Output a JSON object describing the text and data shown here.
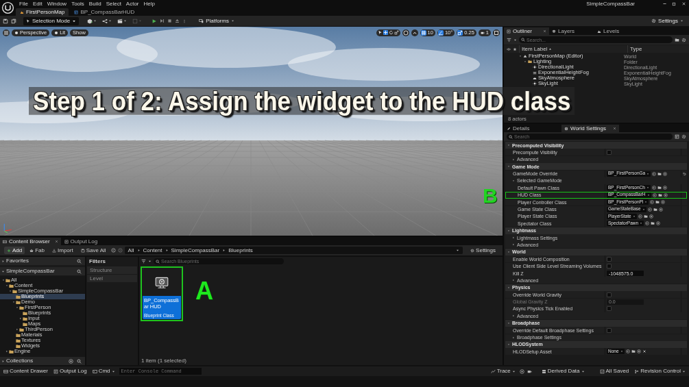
{
  "menu_bar": {
    "menus": [
      "File",
      "Edit",
      "Window",
      "Tools",
      "Build",
      "Select",
      "Actor",
      "Help"
    ],
    "project": "SimpleCompassBar"
  },
  "document_tabs": [
    {
      "label": "FirstPersonMap",
      "kind": "level",
      "selected": true
    },
    {
      "label": "BP_CompassBarHUD",
      "kind": "blueprint",
      "selected": false
    }
  ],
  "toolbar": {
    "mode": "Selection Mode",
    "platforms": "Platforms",
    "settings": "Settings"
  },
  "viewport": {
    "view": "Perspective",
    "lighting": "Lit",
    "show": "Show",
    "grid_snap": "10",
    "rotation_snap": "10°",
    "scale_snap": "0.25",
    "camera_speed": "1",
    "overlay_title": "Step 1 of 2: Assign the widget to the HUD class",
    "marker": "B"
  },
  "outliner": {
    "tabs": [
      {
        "label": "Outliner",
        "selected": true
      },
      {
        "label": "Layers",
        "selected": false
      },
      {
        "label": "Levels",
        "selected": false
      }
    ],
    "search_placeholder": "Search...",
    "columns": [
      "Item Label",
      "Type"
    ],
    "rows": [
      {
        "label": "FirstPersonMap (Editor)",
        "type": "World",
        "kind": "world",
        "expanded": true,
        "children": [
          {
            "label": "Lighting",
            "type": "Folder",
            "kind": "folder",
            "expanded": true,
            "children": [
              {
                "label": "DirectionalLight",
                "type": "DirectionalLight",
                "kind": "light"
              },
              {
                "label": "ExponentialHeightFog",
                "type": "ExponentialHeightFog",
                "kind": "fog"
              },
              {
                "label": "SkyAtmosphere",
                "type": "SkyAtmosphere",
                "kind": "sky"
              },
              {
                "label": "SkyLight",
                "type": "SkyLight",
                "kind": "light"
              }
            ]
          }
        ]
      }
    ],
    "footer": "8 actors"
  },
  "details": {
    "tabs": [
      {
        "label": "Details",
        "selected": false
      },
      {
        "label": "World Settings",
        "selected": true
      }
    ],
    "search_placeholder": "Search",
    "rows": [
      {
        "kind": "category",
        "label": "Precomputed Visibility",
        "expanded": true,
        "children": [
          {
            "kind": "checkbox",
            "label": "Precompute Visibility",
            "checked": false
          },
          {
            "kind": "group",
            "label": "Advanced",
            "expanded": false
          }
        ]
      },
      {
        "kind": "category",
        "label": "Game Mode",
        "expanded": true,
        "children": [
          {
            "kind": "asset",
            "label": "GameMode Override",
            "value": "BP_FirstPersonGa",
            "modified": true
          },
          {
            "kind": "group",
            "label": "Selected GameMode",
            "expanded": true,
            "children": [
              {
                "kind": "asset",
                "label": "Default Pawn Class",
                "value": "BP_FirstPersonCh"
              },
              {
                "kind": "asset",
                "label": "HUD Class",
                "value": "BP_CompassBarH",
                "highlighted": true
              },
              {
                "kind": "asset",
                "label": "Player Controller Class",
                "value": "BP_FirstPersonPl"
              },
              {
                "kind": "asset",
                "label": "Game State Class",
                "value": "GameStateBase"
              },
              {
                "kind": "asset",
                "label": "Player State Class",
                "value": "PlayerState"
              },
              {
                "kind": "asset",
                "label": "Spectator Class",
                "value": "SpectatorPawn"
              }
            ]
          }
        ]
      },
      {
        "kind": "category",
        "label": "Lightmass",
        "expanded": true,
        "children": [
          {
            "kind": "group",
            "label": "Lightmass Settings",
            "expanded": false
          },
          {
            "kind": "group",
            "label": "Advanced",
            "expanded": false
          }
        ]
      },
      {
        "kind": "category",
        "label": "World",
        "expanded": true,
        "children": [
          {
            "kind": "checkbox",
            "label": "Enable World Composition",
            "checked": false
          },
          {
            "kind": "checkbox",
            "label": "Use Client Side Level Streaming Volumes",
            "checked": false
          },
          {
            "kind": "number",
            "label": "Kill Z",
            "value": "-1048575.0",
            "disabled": false
          },
          {
            "kind": "group",
            "label": "Advanced",
            "expanded": false
          }
        ]
      },
      {
        "kind": "category",
        "label": "Physics",
        "expanded": true,
        "children": [
          {
            "kind": "checkbox",
            "label": "Override World Gravity",
            "checked": false
          },
          {
            "kind": "number",
            "label": "Global Gravity Z",
            "value": "0.0",
            "disabled": true
          },
          {
            "kind": "checkbox",
            "label": "Async Physics Tick Enabled",
            "checked": false
          },
          {
            "kind": "group",
            "label": "Advanced",
            "expanded": false
          }
        ]
      },
      {
        "kind": "category",
        "label": "Broadphase",
        "expanded": true,
        "children": [
          {
            "kind": "checkbox",
            "label": "Override Default Broadphase Settings",
            "checked": false
          },
          {
            "kind": "group",
            "label": "Broadphase Settings",
            "expanded": false
          }
        ]
      },
      {
        "kind": "category",
        "label": "HLODSystem",
        "expanded": true,
        "children": [
          {
            "kind": "asset",
            "label": "HLODSetup Asset",
            "value": "None",
            "clearable": true
          }
        ]
      }
    ]
  },
  "content_browser": {
    "tabs": [
      {
        "label": "Content Browser",
        "selected": true
      },
      {
        "label": "Output Log",
        "selected": false
      }
    ],
    "actions": [
      "Add",
      "Fab",
      "Import",
      "Save All"
    ],
    "breadcrumb": [
      "All",
      "Content",
      "SimpleCompassBar",
      "Blueprints"
    ],
    "settings": "Settings",
    "favorites": "Favorites",
    "project": "SimpleCompassBar",
    "tree": [
      {
        "label": "All",
        "expanded": true,
        "selected": false,
        "children": [
          {
            "label": "Content",
            "expanded": true,
            "selected": false,
            "children": [
              {
                "label": "SimpleCompassBar",
                "expanded": true,
                "selected": false,
                "children": [
                  {
                    "label": "Blueprints",
                    "selected": true
                  },
                  {
                    "label": "Demo",
                    "expanded": true,
                    "selected": false,
                    "children": [
                      {
                        "label": "FirstPerson",
                        "expanded": true,
                        "selected": false,
                        "children": [
                          {
                            "label": "Blueprints",
                            "selected": false
                          },
                          {
                            "label": "Input",
                            "expanded": false,
                            "selected": false
                          },
                          {
                            "label": "Maps",
                            "selected": false
                          }
                        ]
                      },
                      {
                        "label": "ThirdPerson",
                        "expanded": false,
                        "selected": false
                      }
                    ]
                  },
                  {
                    "label": "Materials",
                    "selected": false
                  },
                  {
                    "label": "Textures",
                    "selected": false
                  },
                  {
                    "label": "Widgets",
                    "selected": false
                  }
                ]
              }
            ]
          },
          {
            "label": "Engine",
            "expanded": false,
            "selected": false
          }
        ]
      }
    ],
    "collections": "Collections",
    "filters": {
      "title": "Filters",
      "items": [
        "Structure",
        "Level"
      ]
    },
    "search_placeholder": "Search Blueprints",
    "assets": [
      {
        "name": "BP_CompassBar HUD",
        "type": "Blueprint Class",
        "selected": true,
        "highlighted": true
      }
    ],
    "status": "1 item (1 selected)",
    "marker": "A"
  },
  "status_bar": {
    "content_drawer": "Content Drawer",
    "output_log": "Output Log",
    "cmd": "Cmd",
    "console_placeholder": "Enter Console Command",
    "trace": "Trace",
    "derived_data": "Derived Data",
    "saved": "All Saved",
    "revision_control": "Revision Control"
  }
}
